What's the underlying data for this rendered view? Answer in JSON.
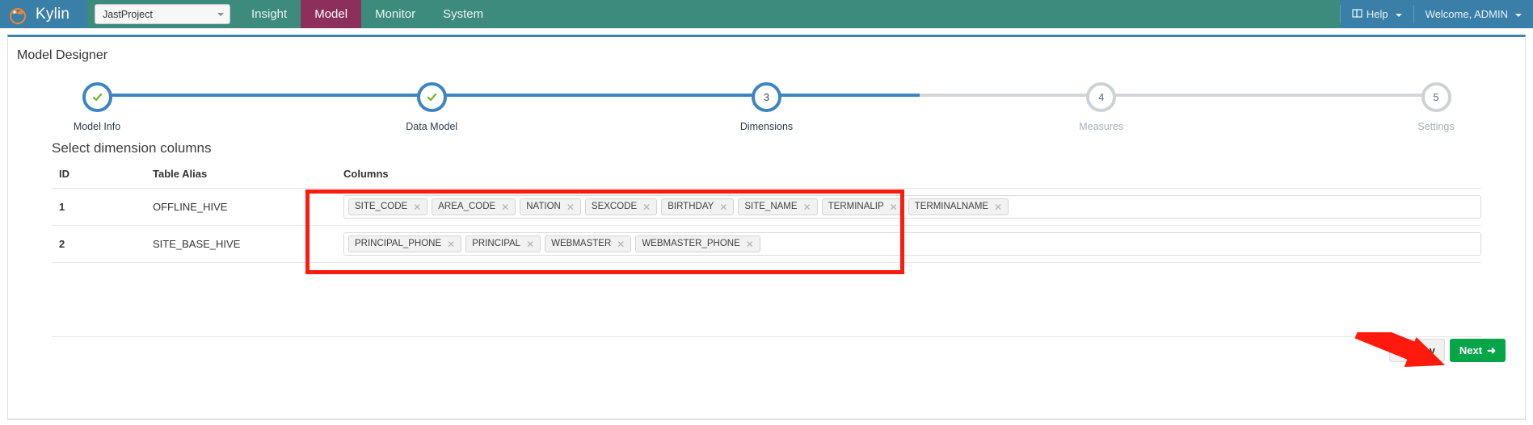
{
  "navbar": {
    "brand": "Kylin",
    "brand_logo_icon": "kylin-logo-icon",
    "project_selector": {
      "value": "JastProject",
      "caret_icon": "chevron-down-icon"
    },
    "items": [
      {
        "label": "Insight",
        "active": false
      },
      {
        "label": "Model",
        "active": true
      },
      {
        "label": "Monitor",
        "active": false
      },
      {
        "label": "System",
        "active": false
      }
    ],
    "right": {
      "help": {
        "label": "Help",
        "icon": "book-icon",
        "caret_icon": "chevron-down-icon"
      },
      "user": {
        "label": "Welcome, ADMIN",
        "caret_icon": "chevron-down-icon"
      }
    }
  },
  "panel": {
    "title": "Model Designer"
  },
  "stepper": {
    "steps": [
      {
        "number": "1",
        "label": "Model Info",
        "state": "done",
        "icon": "check-icon"
      },
      {
        "number": "2",
        "label": "Data Model",
        "state": "done",
        "icon": "check-icon"
      },
      {
        "number": "3",
        "label": "Dimensions",
        "state": "active",
        "icon": ""
      },
      {
        "number": "4",
        "label": "Measures",
        "state": "inactive",
        "icon": ""
      },
      {
        "number": "5",
        "label": "Settings",
        "state": "inactive",
        "icon": ""
      }
    ]
  },
  "content": {
    "section_title": "Select dimension columns",
    "table": {
      "headers": [
        "ID",
        "Table Alias",
        "Columns"
      ],
      "rows": [
        {
          "id": "1",
          "alias": "OFFLINE_HIVE",
          "columns": [
            "SITE_CODE",
            "AREA_CODE",
            "NATION",
            "SEXCODE",
            "BIRTHDAY",
            "SITE_NAME",
            "TERMINALIP",
            "TERMINALNAME"
          ]
        },
        {
          "id": "2",
          "alias": "SITE_BASE_HIVE",
          "columns": [
            "PRINCIPAL_PHONE",
            "PRINCIPAL",
            "WEBMASTER",
            "WEBMASTER_PHONE"
          ]
        }
      ]
    }
  },
  "footer": {
    "prev_label": "Prev",
    "next_label": "Next",
    "prev_icon": "arrow-left-icon",
    "next_icon": "arrow-right-icon"
  },
  "annotations": {
    "highlight_box_color": "#ff1a0d",
    "arrow_color": "#ff1a0d",
    "arrow_icon": "red-pointer-arrow-icon"
  },
  "colors": {
    "nav_green": "#3d8b7d",
    "nav_blue": "#3a7fa8",
    "nav_active": "#8c2f5a",
    "step_blue": "#3d85c0",
    "check_green": "#7ab82b",
    "next_green": "#06a54a"
  }
}
